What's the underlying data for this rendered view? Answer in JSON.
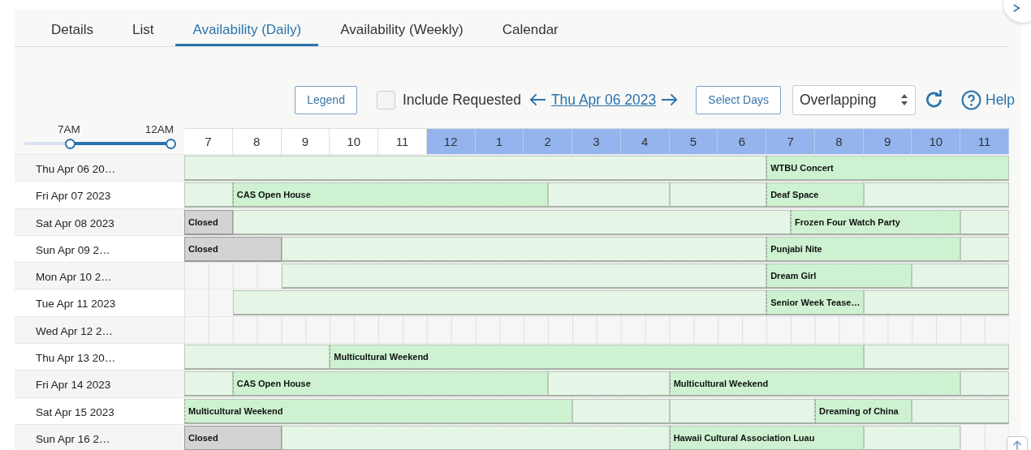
{
  "tabs": [
    {
      "label": "Details",
      "selected": false
    },
    {
      "label": "List",
      "selected": false
    },
    {
      "label": "Availability (Daily)",
      "selected": true
    },
    {
      "label": "Availability (Weekly)",
      "selected": false
    },
    {
      "label": "Calendar",
      "selected": false
    }
  ],
  "toolbar": {
    "legend_button": "Legend",
    "include_requested": {
      "label": "Include Requested",
      "checked": false
    },
    "date": "Thu Apr 06 2023",
    "select_days_button": "Select Days",
    "mode_select": {
      "value": "Overlapping"
    },
    "help": "Help"
  },
  "time_range": {
    "start": {
      "label": "7AM",
      "level": 0.31
    },
    "end": {
      "label": "12AM",
      "level": 1
    }
  },
  "hours": [
    {
      "label": "7",
      "shaded": false
    },
    {
      "label": "8",
      "shaded": false
    },
    {
      "label": "9",
      "shaded": false
    },
    {
      "label": "10",
      "shaded": false
    },
    {
      "label": "11",
      "shaded": false
    },
    {
      "label": "12",
      "shaded": true
    },
    {
      "label": "1",
      "shaded": true
    },
    {
      "label": "2",
      "shaded": true
    },
    {
      "label": "3",
      "shaded": true
    },
    {
      "label": "4",
      "shaded": true
    },
    {
      "label": "5",
      "shaded": true
    },
    {
      "label": "6",
      "shaded": true
    },
    {
      "label": "7",
      "shaded": true
    },
    {
      "label": "8",
      "shaded": true
    },
    {
      "label": "9",
      "shaded": true
    },
    {
      "label": "10",
      "shaded": true
    },
    {
      "label": "11",
      "shaded": true
    }
  ],
  "rows": [
    {
      "date": "Thu Apr 06 20…",
      "blocks": [
        {
          "kind": "free"
        },
        {
          "kind": "event",
          "label": "WTBU Concert"
        }
      ]
    },
    {
      "date": "Fri Apr 07 2023",
      "blocks": [
        {
          "kind": "free"
        },
        {
          "kind": "event",
          "label": "CAS Open House"
        },
        {
          "kind": "free"
        },
        {
          "kind": "free"
        },
        {
          "kind": "event",
          "label": "Deaf Space"
        },
        {
          "kind": "free"
        }
      ]
    },
    {
      "date": "Sat Apr 08 2023",
      "blocks": [
        {
          "kind": "closed",
          "label": "Closed"
        },
        {
          "kind": "free"
        },
        {
          "kind": "event",
          "label": "Frozen Four Watch Party"
        },
        {
          "kind": "free"
        }
      ]
    },
    {
      "date": "Sun Apr 09 2…",
      "blocks": [
        {
          "kind": "closed",
          "label": "Closed"
        },
        {
          "kind": "free"
        },
        {
          "kind": "event",
          "label": "Punjabi Nite"
        },
        {
          "kind": "free"
        }
      ]
    },
    {
      "date": "Mon Apr 10 2…",
      "blocks": [
        {
          "kind": "free"
        },
        {
          "kind": "event",
          "label": "Dream Girl"
        },
        {
          "kind": "free"
        }
      ]
    },
    {
      "date": "Tue Apr 11 2023",
      "blocks": [
        {
          "kind": "free"
        },
        {
          "kind": "event",
          "label": "Senior Week Tease…"
        },
        {
          "kind": "free"
        }
      ]
    },
    {
      "date": "Wed Apr 12 2…"
    },
    {
      "date": "Thu Apr 13 20…",
      "blocks": [
        {
          "kind": "free"
        },
        {
          "kind": "event",
          "label": "Multicultural Weekend"
        },
        {
          "kind": "free"
        }
      ]
    },
    {
      "date": "Fri Apr 14 2023",
      "blocks": [
        {
          "kind": "free"
        },
        {
          "kind": "event",
          "label": "CAS Open House"
        },
        {
          "kind": "free"
        },
        {
          "kind": "event",
          "label": "Multicultural Weekend"
        },
        {
          "kind": "free"
        }
      ]
    },
    {
      "date": "Sat Apr 15 2023",
      "blocks": [
        {
          "kind": "event",
          "label": "Multicultural Weekend"
        },
        {
          "kind": "free"
        },
        {
          "kind": "free"
        },
        {
          "kind": "event",
          "label": "Dreaming of China"
        },
        {
          "kind": "free"
        }
      ]
    },
    {
      "date": "Sun Apr 16 2…",
      "blocks": [
        {
          "kind": "closed",
          "label": "Closed"
        },
        {
          "kind": "free"
        },
        {
          "kind": "event",
          "label": "Hawaii Cultural Association Luau"
        },
        {
          "kind": "free"
        }
      ]
    }
  ]
}
